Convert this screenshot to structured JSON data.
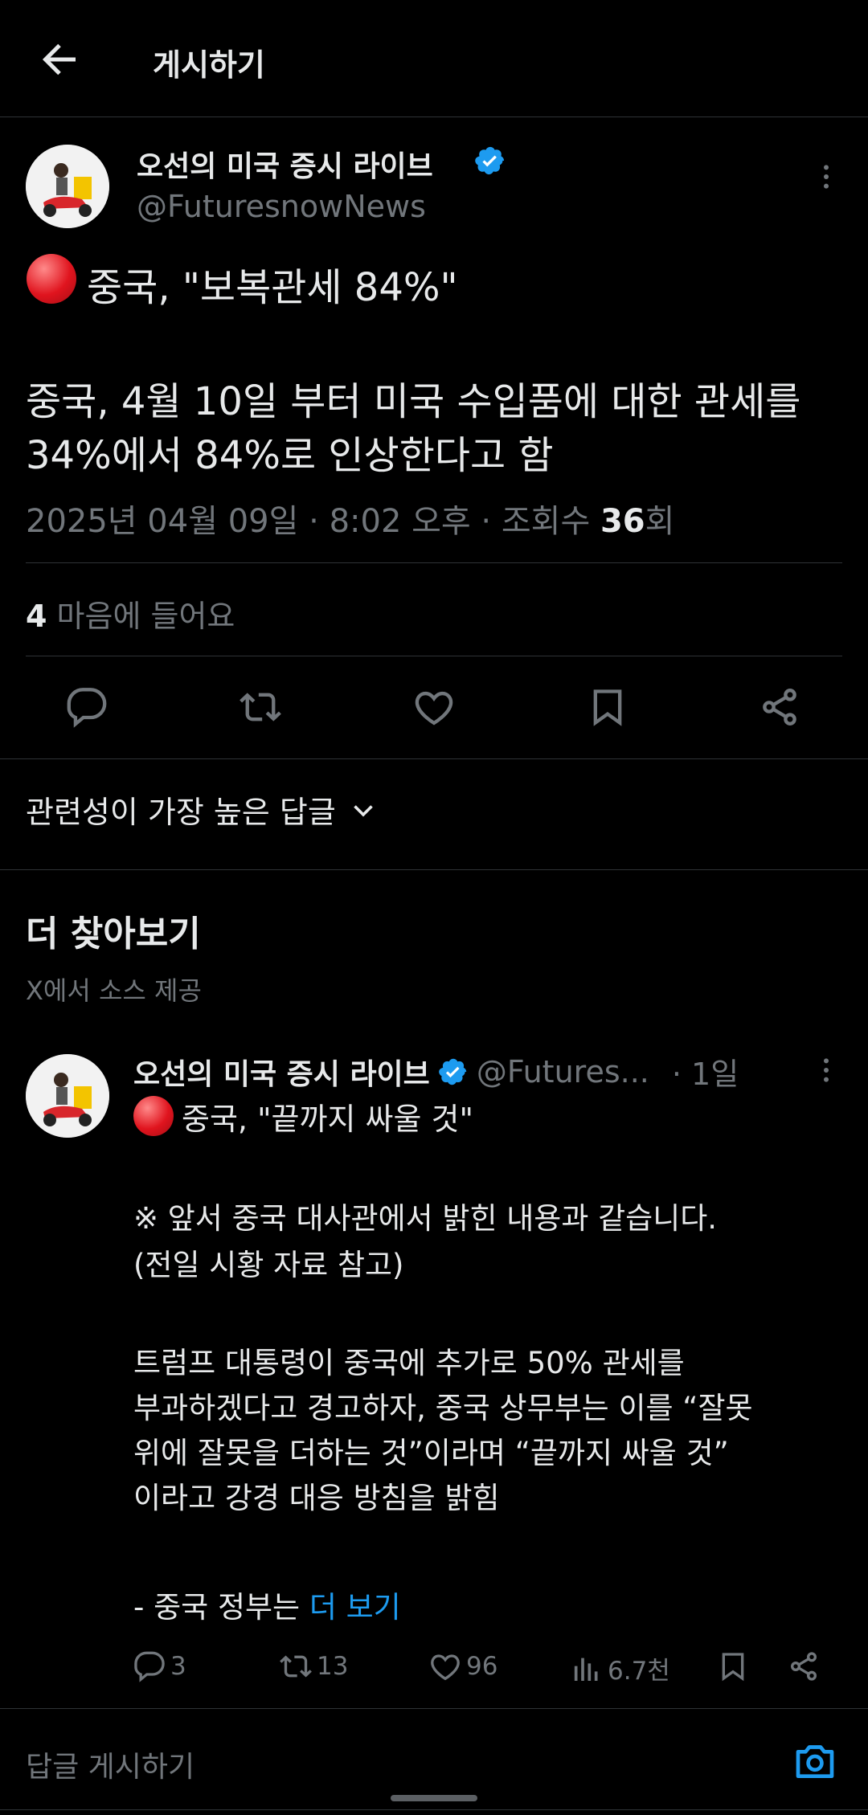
{
  "header": {
    "title": "게시하기"
  },
  "post": {
    "author_name": "오선의 미국 증시 라이브",
    "handle": "@FuturesnowNews",
    "headline": "중국, \"보복관세 84%\"",
    "body_line1": "중국, 4월 10일 부터 미국 수입품에 대한 관세를",
    "body_line2": "34%에서 84%로 인상한다고 함",
    "meta_date": "2025년 04월 09일 · 8:02 오후 · 조회수 ",
    "meta_views": "36",
    "meta_views_suffix": "회",
    "likes_count": "4",
    "likes_label": " 마음에 들어요"
  },
  "replies_sort": {
    "label": "관련성이 가장 높은 답글"
  },
  "discover": {
    "title": "더 찾아보기",
    "subtitle": "X에서 소스 제공"
  },
  "related_post": {
    "author_name": "오선의 미국 증시 라이브",
    "handle": "@Futures...",
    "time": "· 1일",
    "headline": "중국, \"끝까지 싸울 것\"",
    "para1_line1": "※ 앞서 중국 대사관에서 밝힌 내용과 같습니다.",
    "para1_line2": "(전일 시황 자료 참고)",
    "para2_line1": "트럼프 대통령이 중국에 추가로 50% 관세를",
    "para2_line2": "부과하겠다고 경고하자, 중국 상무부는 이를 “잘못",
    "para2_line3": "위에 잘못을 더하는 것”이라며 “끝까지 싸울 것”",
    "para2_line4": "이라고 강경 대응 방침을 밝힘",
    "para3_prefix": "- 중국 정부는 ",
    "more_link": "더 보기",
    "replies": "3",
    "reposts": "13",
    "likes": "96",
    "views": "6.7천"
  },
  "compose": {
    "placeholder": "답글 게시하기"
  },
  "colors": {
    "accent": "#1d9bf0",
    "background": "#000000",
    "text": "#e7e9ea",
    "muted": "#71767b",
    "divider": "#2f3336"
  },
  "icons": [
    "back-arrow-icon",
    "verified-badge-icon",
    "more-icon",
    "red-circle-emoji",
    "reply-icon",
    "repost-icon",
    "like-icon",
    "bookmark-icon",
    "share-icon",
    "chevron-down-icon",
    "views-icon",
    "camera-icon"
  ]
}
